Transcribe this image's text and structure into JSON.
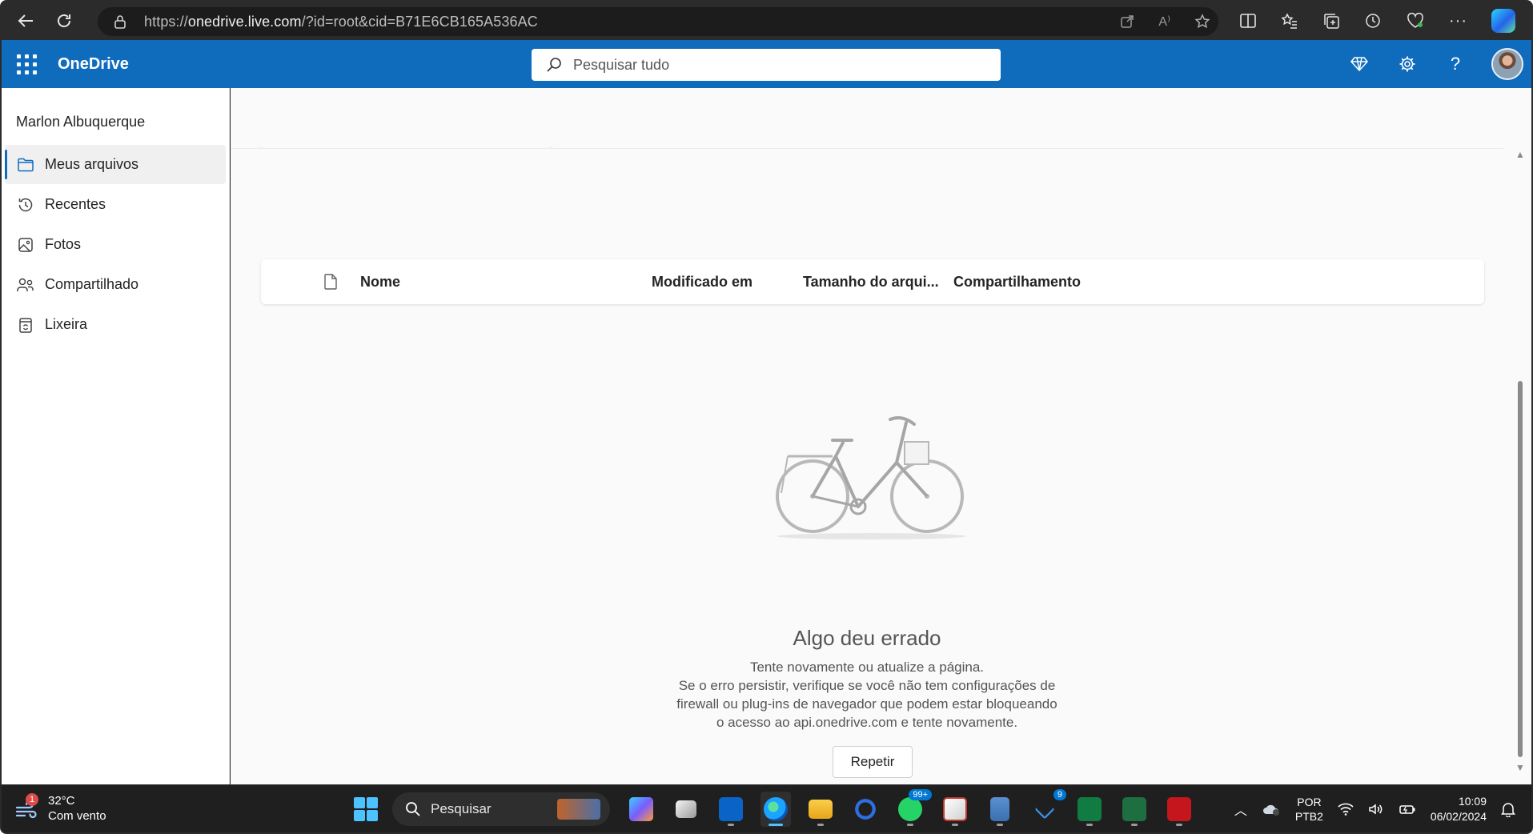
{
  "browser": {
    "url_prefix": "https://",
    "url_host": "onedrive.live.com",
    "url_path": "/?id=root&cid=B71E6CB165A536AC"
  },
  "header": {
    "brand": "OneDrive",
    "search_placeholder": "Pesquisar tudo",
    "accent_color": "#0f6cbd"
  },
  "sidebar": {
    "user_name": "Marlon Albuquerque",
    "items": [
      {
        "label": "Meus arquivos",
        "icon": "folder-icon",
        "active": true
      },
      {
        "label": "Recentes",
        "icon": "history-icon",
        "active": false
      },
      {
        "label": "Fotos",
        "icon": "image-icon",
        "active": false
      },
      {
        "label": "Compartilhado",
        "icon": "people-icon",
        "active": false
      },
      {
        "label": "Lixeira",
        "icon": "recycle-bin-icon",
        "active": false
      }
    ]
  },
  "file_list": {
    "columns": [
      "Nome",
      "Modificado em",
      "Tamanho do arqui...",
      "Compartilhamento"
    ]
  },
  "error": {
    "title": "Algo deu errado",
    "lines": [
      "Tente novamente ou atualize a página.",
      "Se o erro persistir, verifique se você não tem configurações de",
      "firewall ou plug-ins de navegador que podem estar bloqueando",
      "o acesso ao api.onedrive.com e tente novamente."
    ],
    "retry_label": "Repetir"
  },
  "taskbar": {
    "weather_temp": "32°C",
    "weather_desc": "Com vento",
    "weather_badge": "1",
    "search_placeholder": "Pesquisar",
    "whatsapp_badge": "99+",
    "todo_badge": "9",
    "lang_top": "POR",
    "lang_bottom": "PTB2",
    "time": "10:09",
    "date": "06/02/2024"
  }
}
